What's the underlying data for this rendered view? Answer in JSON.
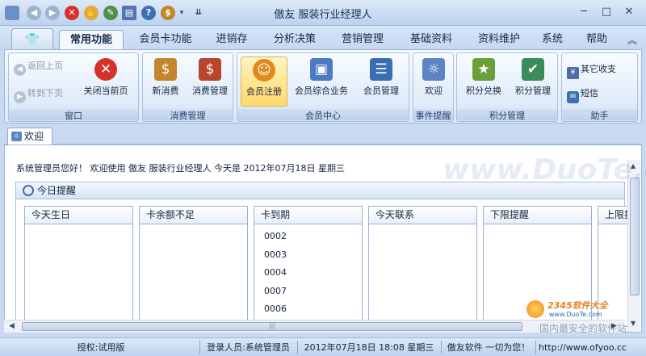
{
  "window": {
    "title": "傲友 服装行业经理人",
    "controls": [
      "─",
      "□",
      "✕"
    ]
  },
  "quick_access": [
    "◀",
    "▶",
    "✕",
    "✋",
    "✎",
    "▤",
    "?",
    "$",
    "▾",
    "⇊"
  ],
  "menu": {
    "tabs": [
      "常用功能",
      "会员卡功能",
      "进销存",
      "分析决策",
      "营销管理",
      "基础资料",
      "资料维护",
      "系统",
      "帮助"
    ],
    "active": "常用功能",
    "collapse_caret": "︽"
  },
  "ribbon": {
    "groups": [
      {
        "label": "窗口",
        "small": [
          "返回上页",
          "转到下页"
        ],
        "big": "关闭当前页"
      },
      {
        "label": "消费管理",
        "big": [
          "新消费",
          "消费管理"
        ]
      },
      {
        "label": "会员中心",
        "big": [
          "会员注册",
          "会员综合业务",
          "会员管理"
        ]
      },
      {
        "label": "事件提醒",
        "big": [
          "欢迎"
        ]
      },
      {
        "label": "积分管理",
        "big": [
          "积分兑换",
          "积分管理"
        ]
      },
      {
        "label": "助手",
        "small": [
          "其它收支",
          "短信"
        ]
      }
    ]
  },
  "doc_tab": {
    "label": "欢迎"
  },
  "welcome": {
    "text": "系统管理员您好！ 欢迎使用 傲友 服装行业经理人 今天是 2012年07月18日 星期三"
  },
  "reminder_panel": {
    "title": "今日提醒",
    "columns": [
      {
        "header": "今天生日",
        "items": []
      },
      {
        "header": "卡余额不足",
        "items": []
      },
      {
        "header": "卡到期",
        "items": [
          "0002",
          "0003",
          "0004",
          "0007",
          "0006"
        ]
      },
      {
        "header": "今天联系",
        "items": []
      },
      {
        "header": "下限提醒",
        "items": []
      },
      {
        "header": "上限提",
        "items": []
      }
    ]
  },
  "scroll": {
    "up": "▲",
    "down": "▼",
    "left": "◀",
    "right": "▶",
    "grip": "|||"
  },
  "status": {
    "license": "授权:试用版",
    "user": "登录人员:系统管理员",
    "datetime": "2012年07月18日 18:08 星期三",
    "slogan": "傲友软件 一切为您！",
    "url": "http://www.ofyoo.cc"
  },
  "watermarks": {
    "main": "www.DuoTe.com",
    "badge_name": "2345软件大全",
    "badge_url": "www.DuoTe.com",
    "badge_slogan": "国内最安全的软件站"
  },
  "colors": {
    "accent": "#3f6fb6",
    "highlight": "#ffd96a",
    "close_red": "#d8312a"
  }
}
